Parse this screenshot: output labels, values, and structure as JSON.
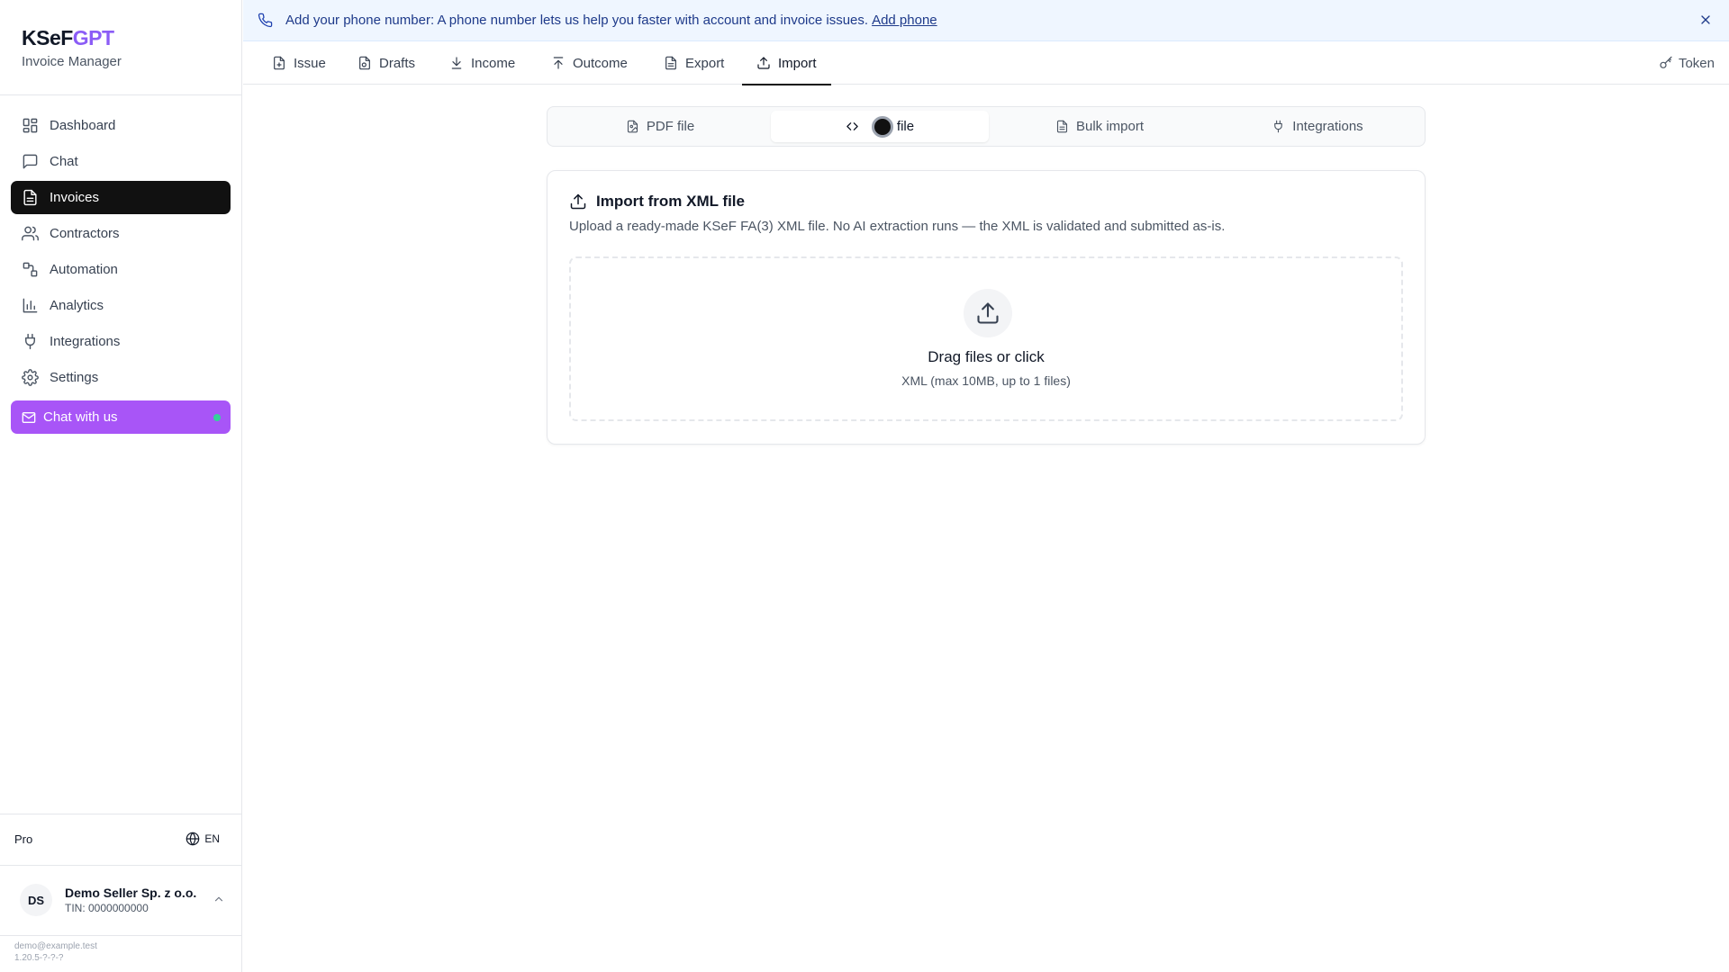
{
  "brand": {
    "name_main": "KSeF",
    "name_accent": "GPT",
    "subtitle": "Invoice Manager",
    "accent_color": "#8b5cf6"
  },
  "sidebar": {
    "items": [
      {
        "label": "Dashboard",
        "icon": "dashboard-icon"
      },
      {
        "label": "Chat",
        "icon": "chat-icon"
      },
      {
        "label": "Invoices",
        "icon": "invoice-icon",
        "active": true
      },
      {
        "label": "Contractors",
        "icon": "users-icon"
      },
      {
        "label": "Automation",
        "icon": "automation-icon"
      },
      {
        "label": "Analytics",
        "icon": "analytics-icon"
      },
      {
        "label": "Integrations",
        "icon": "plug-icon"
      },
      {
        "label": "Settings",
        "icon": "gear-icon"
      }
    ],
    "chat_button": {
      "label": "Chat with us",
      "color": "#a855f7",
      "status_color": "#34d399"
    },
    "plan": "Pro",
    "language": "EN",
    "account": {
      "initials": "DS",
      "name": "Demo Seller Sp. z o.o.",
      "tin": "TIN: 0000000000"
    },
    "footer": {
      "email": "demo@example.test",
      "version": "1.20.5-?-?-?"
    }
  },
  "banner": {
    "text": "Add your phone number: A phone number lets us help you faster with account and invoice issues.",
    "link": "Add phone"
  },
  "tabs": [
    {
      "label": "Issue",
      "icon": "file-plus-icon"
    },
    {
      "label": "Drafts",
      "icon": "drafts-icon"
    },
    {
      "label": "Income",
      "icon": "download-icon"
    },
    {
      "label": "Outcome",
      "icon": "upload-icon"
    },
    {
      "label": "Export",
      "icon": "file-text-icon"
    },
    {
      "label": "Import",
      "icon": "upload-icon",
      "active": true
    }
  ],
  "token": {
    "label": "Token"
  },
  "subtabs": [
    {
      "label": "PDF file",
      "icon": "file-image-icon"
    },
    {
      "label": "file",
      "icon": "code-icon",
      "active": true
    },
    {
      "label": "Bulk import",
      "icon": "file-text-icon"
    },
    {
      "label": "Integrations",
      "icon": "plug-icon"
    }
  ],
  "card": {
    "title": "Import from XML file",
    "description": "Upload a ready-made KSeF FA(3) XML file. No AI extraction runs — the XML is validated and submitted as-is.",
    "dropzone": {
      "title": "Drag files or click",
      "subtitle": "XML (max 10MB, up to 1 files)"
    }
  }
}
